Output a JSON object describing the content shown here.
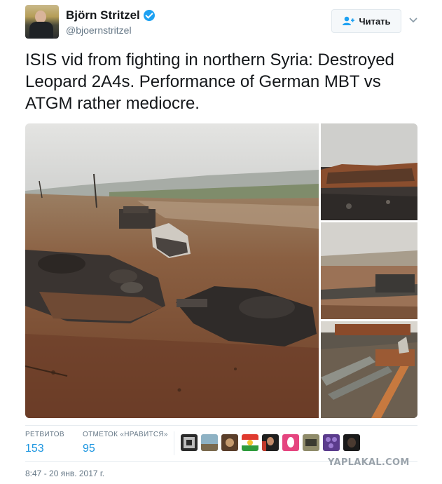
{
  "author": {
    "name": "Björn Stritzel",
    "handle": "@bjoernstritzel",
    "verified": true
  },
  "follow_button": {
    "label": "Читать",
    "icon": "add-user-icon"
  },
  "tweet": {
    "text": "ISIS vid from fighting in northern Syria: Destroyed Leopard 2A4s. Performance of German MBT vs ATGM rather mediocre."
  },
  "stats": {
    "retweets_label": "РЕТВИТОВ",
    "retweets_count": "153",
    "likes_label": "ОТМЕТОК «НРАВИТСЯ»",
    "likes_count": "95"
  },
  "timestamp": "8:47 - 20 янв. 2017 г.",
  "watermark": "YAPLAKAL.COM",
  "colors": {
    "link_blue": "#1b95e0",
    "verified_blue": "#1da1f2",
    "muted_gray": "#657786"
  }
}
